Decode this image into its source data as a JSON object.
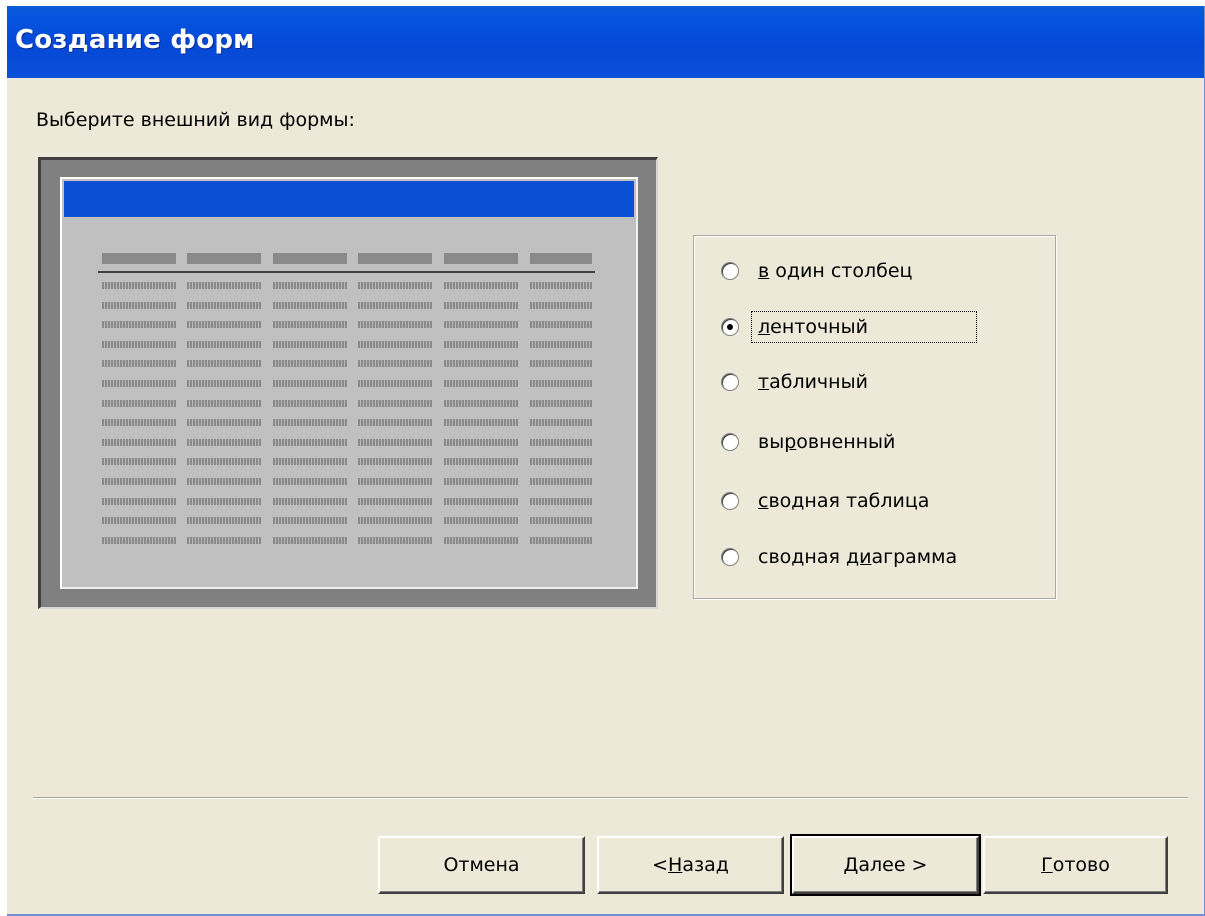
{
  "window": {
    "title": "Создание форм"
  },
  "prompt": "Выберите внешний вид формы:",
  "options": [
    {
      "label_pre": "",
      "label_ul": "в",
      "label_post": " один столбец",
      "checked": false
    },
    {
      "label_pre": "",
      "label_ul": "л",
      "label_post": "енточный",
      "checked": true
    },
    {
      "label_pre": "",
      "label_ul": "т",
      "label_post": "абличный",
      "checked": false
    },
    {
      "label_pre": "вы",
      "label_ul": "р",
      "label_post": "овненный",
      "checked": false
    },
    {
      "label_pre": "",
      "label_ul": "с",
      "label_post": "водная таблица",
      "checked": false
    },
    {
      "label_pre": "сводная ",
      "label_ul": "ди",
      "label_post": "аграмма",
      "checked": false
    }
  ],
  "buttons": {
    "cancel": {
      "pre": "",
      "ul": "",
      "post": "Отмена"
    },
    "back": {
      "pre": "< ",
      "ul": "Н",
      "post": "азад"
    },
    "next": {
      "pre": "",
      "ul": "Д",
      "post": "алее >"
    },
    "finish": {
      "pre": "",
      "ul": "Г",
      "post": "отово"
    }
  },
  "colors": {
    "title_bar": "#0448d6",
    "dialog_bg": "#ece9d8",
    "preview_header": "#0a50d4"
  }
}
